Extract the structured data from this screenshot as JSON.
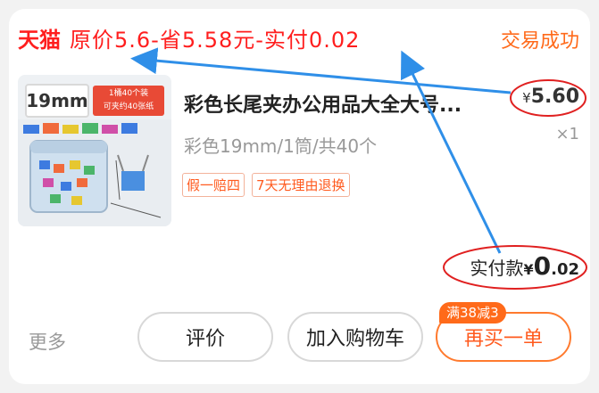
{
  "header": {
    "brand": "天猫",
    "note": "原价5.6-省5.58元-实付0.02",
    "status": "交易成功"
  },
  "product": {
    "thumb_size_label": "19mm",
    "thumb_tag_line1": "1桶40个装",
    "thumb_tag_line2": "可夹约40张纸",
    "title": "彩色长尾夹办公用品大全大号...",
    "spec": "彩色19mm/1筒/共40个",
    "tags": [
      "假一赔四",
      "7天无理由退换"
    ],
    "price_currency": "¥",
    "price_value": "5.60",
    "quantity": "×1"
  },
  "payment": {
    "label": "实付款",
    "currency": "¥",
    "integer": "0",
    "decimal": ".02"
  },
  "actions": {
    "more": "更多",
    "review": "评价",
    "add_to_cart": "加入购物车",
    "rebuy": "再买一单",
    "promo_badge": "满38减3"
  },
  "colors": {
    "tmall_red": "#ff1e1e",
    "accent_orange": "#ff6a1a",
    "annotation_blue": "#2f8fe8",
    "annotation_red": "#e02020"
  }
}
